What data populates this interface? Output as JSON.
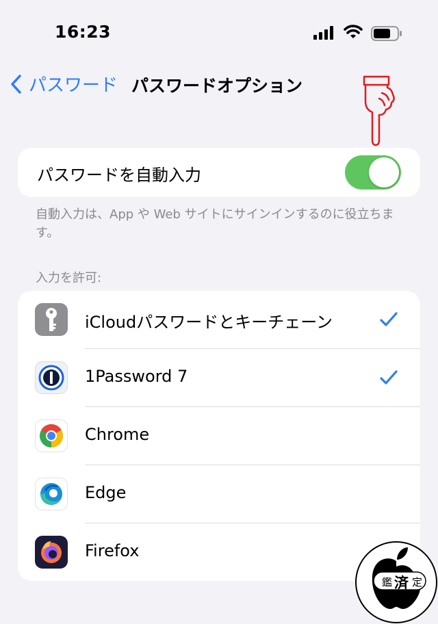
{
  "status_bar": {
    "time": "16:23"
  },
  "nav": {
    "back_label": "パスワード",
    "title": "パスワードオプション"
  },
  "autofill": {
    "label": "パスワードを自動入力",
    "enabled": true,
    "toggle_color": "#5fc65f",
    "footnote": "自動入力は、App や Web サイトにサインインするのに役立ちます。"
  },
  "allow_section": {
    "header": "入力を許可:",
    "apps": [
      {
        "name": "iCloudパスワードとキーチェーン",
        "icon": "key-icon",
        "checked": true
      },
      {
        "name": "1Password 7",
        "icon": "1password-icon",
        "checked": true
      },
      {
        "name": "Chrome",
        "icon": "chrome-icon",
        "checked": false
      },
      {
        "name": "Edge",
        "icon": "edge-icon",
        "checked": false
      },
      {
        "name": "Firefox",
        "icon": "firefox-icon",
        "checked": false
      }
    ]
  },
  "stamp": {
    "text_left": "鑑",
    "text_center": "済",
    "text_right": "定"
  },
  "colors": {
    "accent": "#2f7cf6",
    "background": "#f2f2f7",
    "secondary_text": "#8a8a8e"
  }
}
